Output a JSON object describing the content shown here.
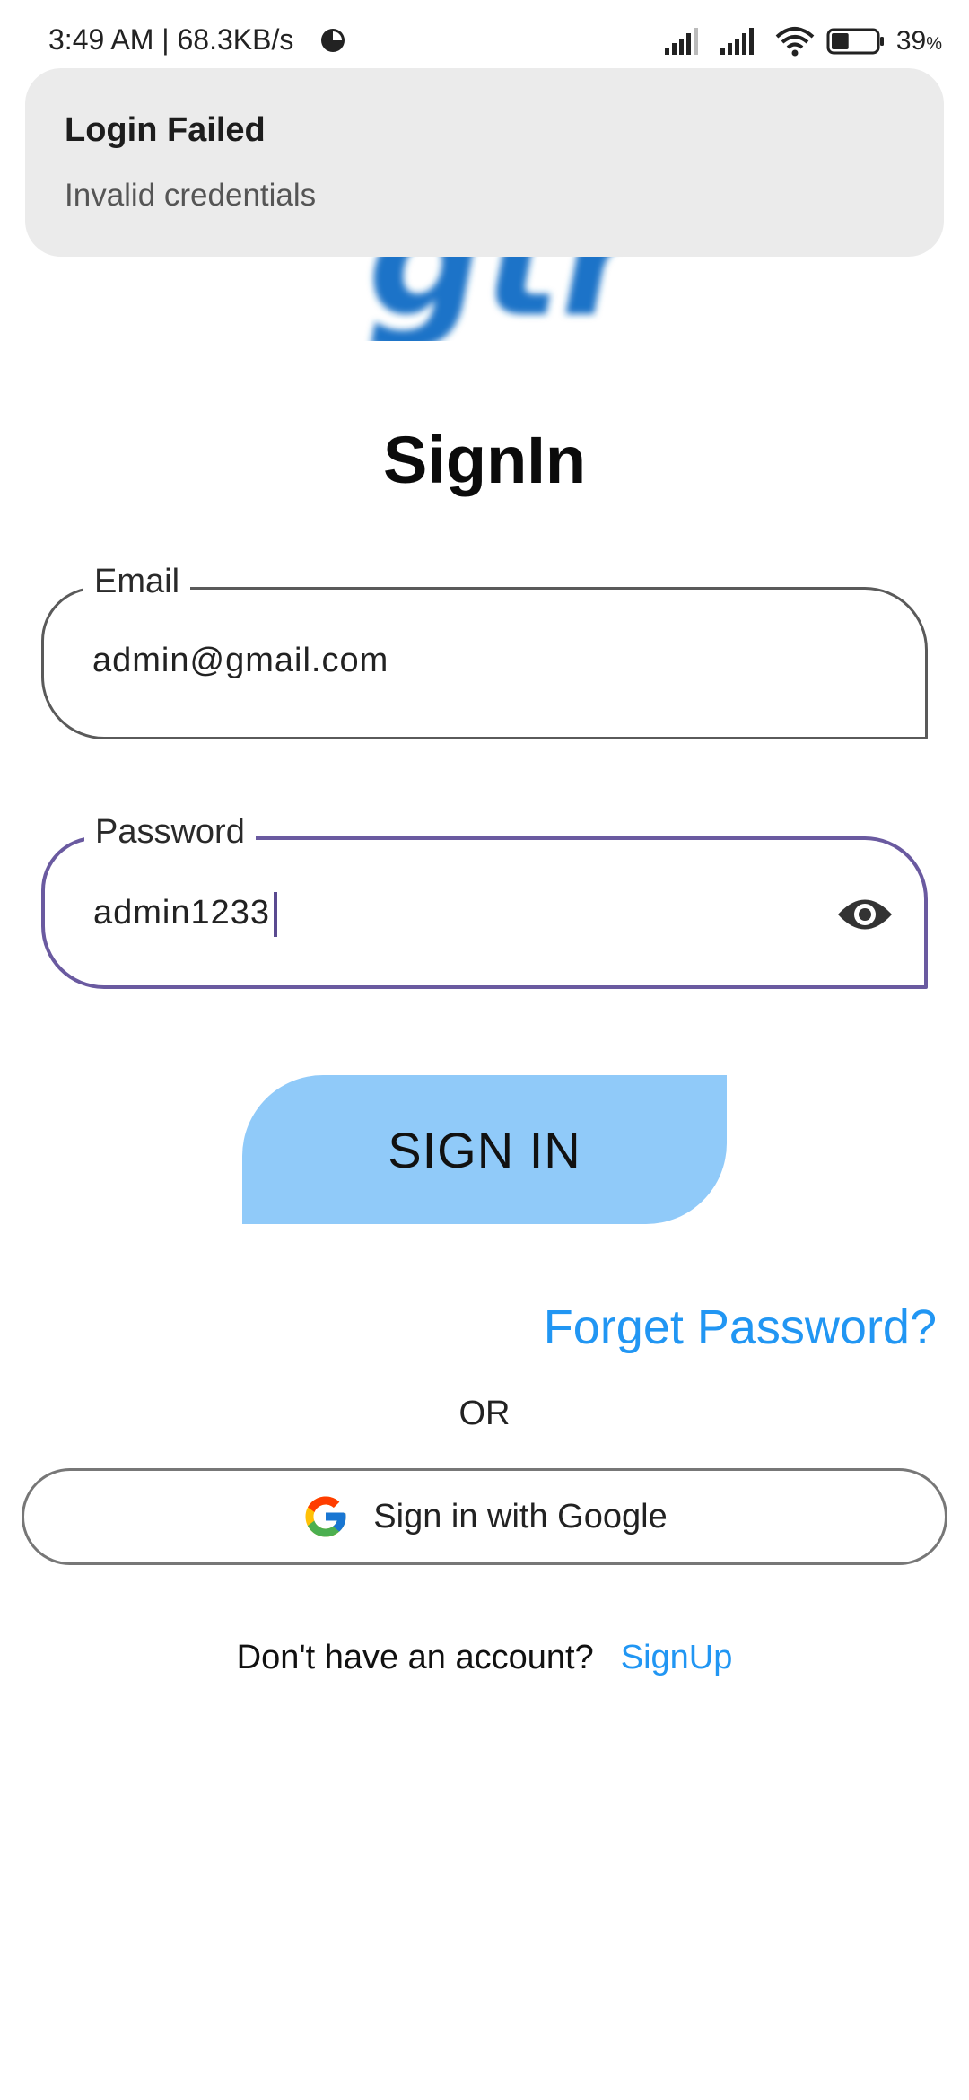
{
  "status_bar": {
    "time_speed": "3:49 AM | 68.3KB/s",
    "battery_percent": "39",
    "battery_unit": "%",
    "battery_level": 0.39
  },
  "toast": {
    "title": "Login Failed",
    "message": "Invalid credentials"
  },
  "page": {
    "title": "SignIn"
  },
  "email": {
    "label": "Email",
    "value": "admin@gmail.com"
  },
  "password": {
    "label": "Password",
    "value": "admin1233"
  },
  "buttons": {
    "sign_in": "SIGN IN",
    "forgot": "Forget Password?",
    "or": "OR",
    "google": "Sign in with Google"
  },
  "signup": {
    "prompt": "Don't have an account?",
    "link": "SignUp"
  },
  "colors": {
    "accent": "#2196f3",
    "button_bg": "#90caf9",
    "focus_border": "#6a5aa0",
    "logo": "#1a73c8"
  },
  "icons": [
    "clock-icon",
    "signal-icon",
    "wifi-icon",
    "battery-icon",
    "eye-icon",
    "google-icon"
  ]
}
